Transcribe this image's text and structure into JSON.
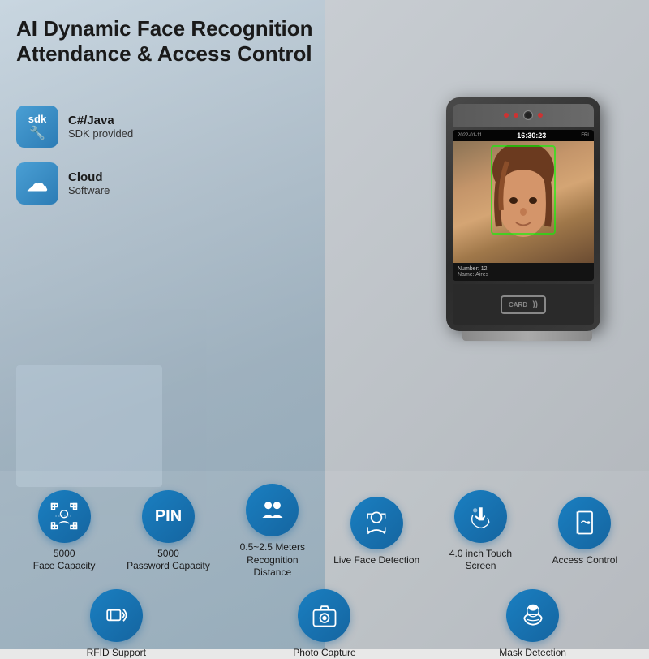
{
  "title": {
    "line1": "AI Dynamic Face Recognition",
    "line2": "Attendance & Access Control"
  },
  "badges": [
    {
      "id": "sdk",
      "icon_label": "sdk",
      "icon_symbol": "sdk",
      "text_main": "C#/Java",
      "text_sub": "SDK provided"
    },
    {
      "id": "cloud",
      "icon_label": "cloud",
      "icon_symbol": "☁",
      "text_main": "Cloud",
      "text_sub": "Software"
    }
  ],
  "device": {
    "date": "2022-01-11",
    "time": "16:30:23",
    "day": "FRI",
    "number_label": "Number: 12",
    "name_label": "Name: Aires",
    "card_text": "CARD"
  },
  "features": [
    {
      "id": "face-capacity",
      "icon": "face",
      "label": "5000\nFace Capacity"
    },
    {
      "id": "password-capacity",
      "icon": "pin",
      "label": "5000\nPassword Capacity"
    },
    {
      "id": "recognition-distance",
      "icon": "person-group",
      "label": "0.5~2.5 Meters\nRecognition Distance"
    },
    {
      "id": "face-detection",
      "icon": "person-detect",
      "label": "Live Face Detection"
    },
    {
      "id": "touch-screen",
      "icon": "touch",
      "label": "4.0 inch Touch Screen"
    },
    {
      "id": "access-control",
      "icon": "door",
      "label": "Access Control"
    },
    {
      "id": "rfid-support",
      "icon": "rfid",
      "label": "RFID Support"
    },
    {
      "id": "photo-capture",
      "icon": "camera",
      "label": "Photo Capture"
    },
    {
      "id": "mask-detection",
      "icon": "mask",
      "label": "Mask Detection"
    }
  ],
  "colors": {
    "blue_primary": "#1a7fc1",
    "blue_dark": "#1565a0",
    "text_dark": "#1a1a1a"
  }
}
